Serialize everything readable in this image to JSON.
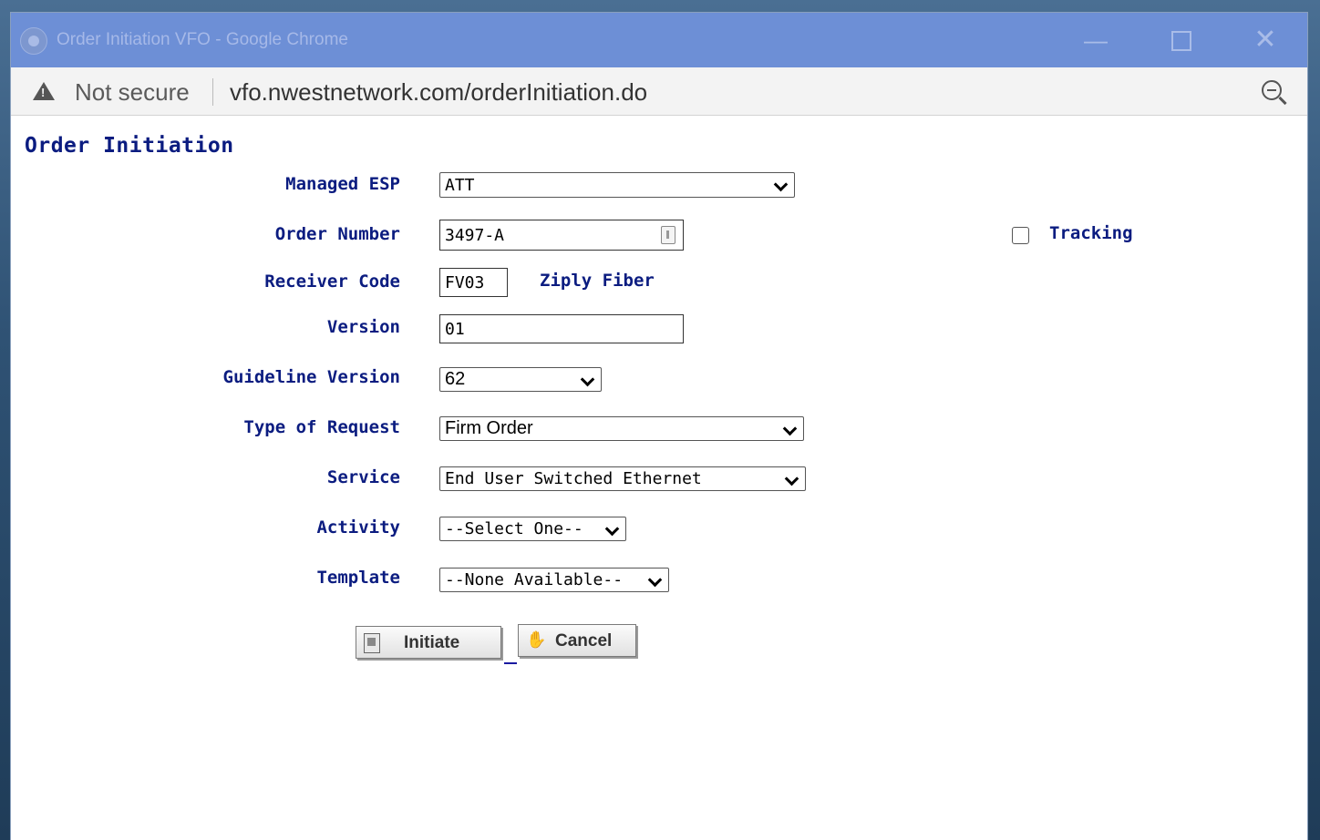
{
  "window": {
    "title": "Order Initiation VFO - Google Chrome",
    "minimize_glyph": "—",
    "close_glyph": "✕"
  },
  "addressbar": {
    "security_text": "Not secure",
    "url": "vfo.nwestnetwork.com/orderInitiation.do"
  },
  "page": {
    "title": "Order Initiation"
  },
  "form": {
    "managed_esp": {
      "label": "Managed ESP",
      "value": "ATT"
    },
    "order_number": {
      "label": "Order Number",
      "value": "3497-A"
    },
    "tracking": {
      "label": "Tracking",
      "checked": false
    },
    "receiver_code": {
      "label": "Receiver Code",
      "value": "FV03",
      "name": "Ziply Fiber"
    },
    "version": {
      "label": "Version",
      "value": "01"
    },
    "guideline_version": {
      "label": "Guideline Version",
      "value": "62"
    },
    "type_of_request": {
      "label": "Type of Request",
      "value": "Firm Order"
    },
    "service": {
      "label": "Service",
      "value": "End User Switched Ethernet"
    },
    "activity": {
      "label": "Activity",
      "value": "--Select One--"
    },
    "template": {
      "label": "Template",
      "value": "--None Available--"
    }
  },
  "buttons": {
    "initiate_label": "Initiate",
    "cancel_label": "Cancel"
  },
  "icons": {
    "browser": "chrome-logo-icon",
    "security": "warning-icon",
    "zoom": "zoom-out-icon",
    "initiate": "document-icon",
    "cancel": "hand-icon"
  },
  "colors": {
    "titlebar": "#6d8fd6",
    "label_text": "#0b1c80"
  }
}
